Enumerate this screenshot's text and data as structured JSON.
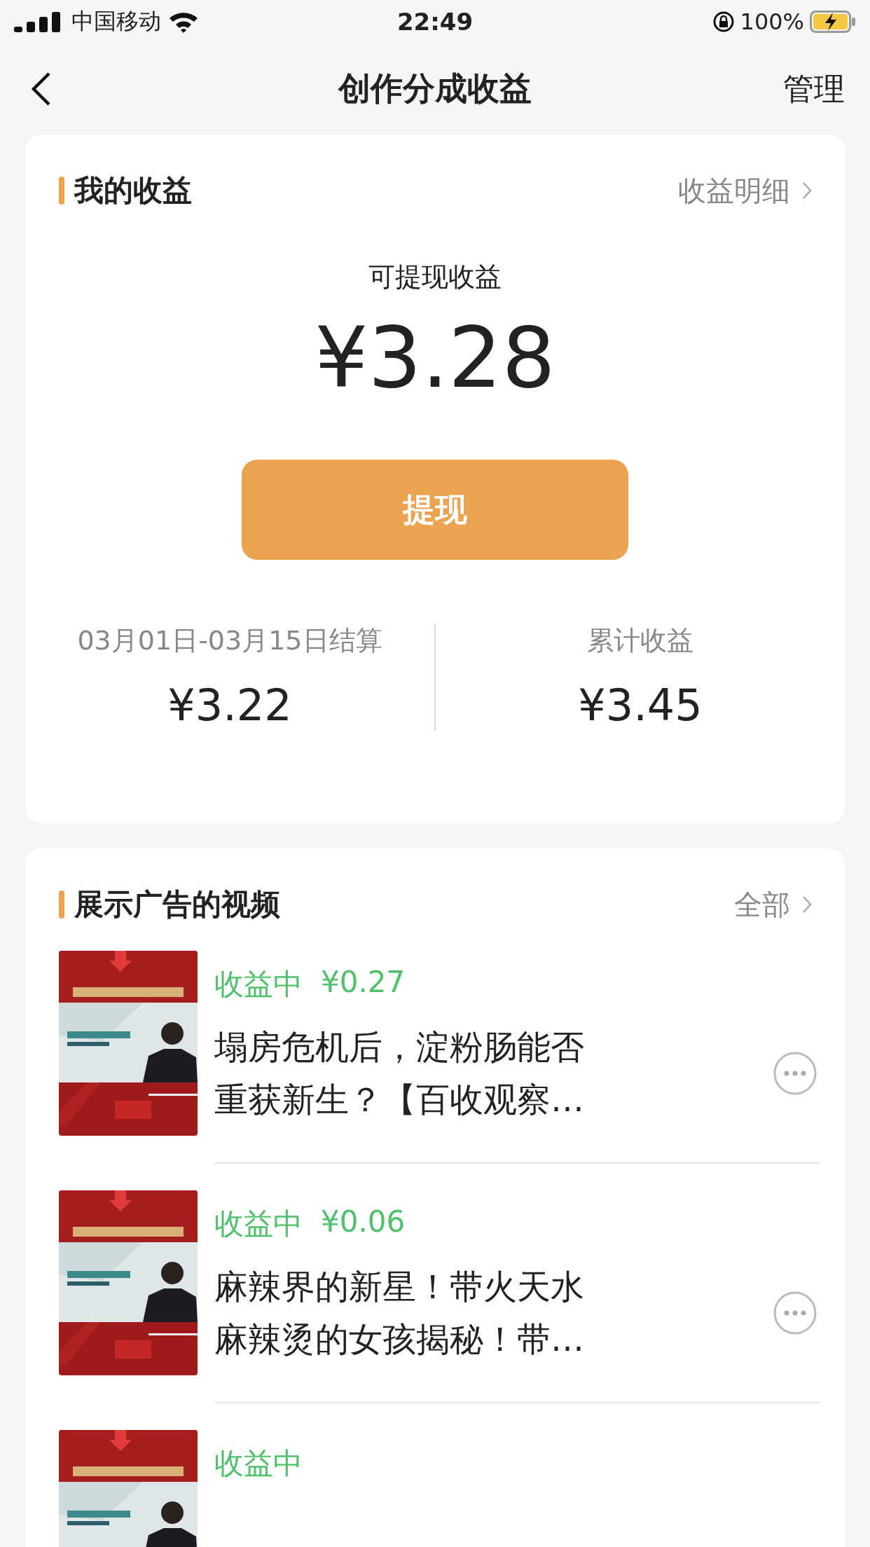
{
  "status_bar": {
    "carrier": "中国移动",
    "time": "22:49",
    "battery": "100%"
  },
  "nav": {
    "title": "创作分成收益",
    "action": "管理"
  },
  "earnings": {
    "title": "我的收益",
    "link": "收益明细",
    "label": "可提现收益",
    "amount": "¥3.28",
    "button": "提现",
    "stats": [
      {
        "label": "03月01日-03月15日结算",
        "value": "¥3.22"
      },
      {
        "label": "累计收益",
        "value": "¥3.45"
      }
    ]
  },
  "videos": {
    "title": "展示广告的视频",
    "link": "全部",
    "items": [
      {
        "status": "收益中",
        "amount": "¥0.27",
        "title": "塌房危机后，淀粉肠能否重获新生？【百收观察…"
      },
      {
        "status": "收益中",
        "amount": "¥0.06",
        "title": "麻辣界的新星！带火天水麻辣烫的女孩揭秘！带…"
      },
      {
        "status": "收益中"
      }
    ]
  }
}
